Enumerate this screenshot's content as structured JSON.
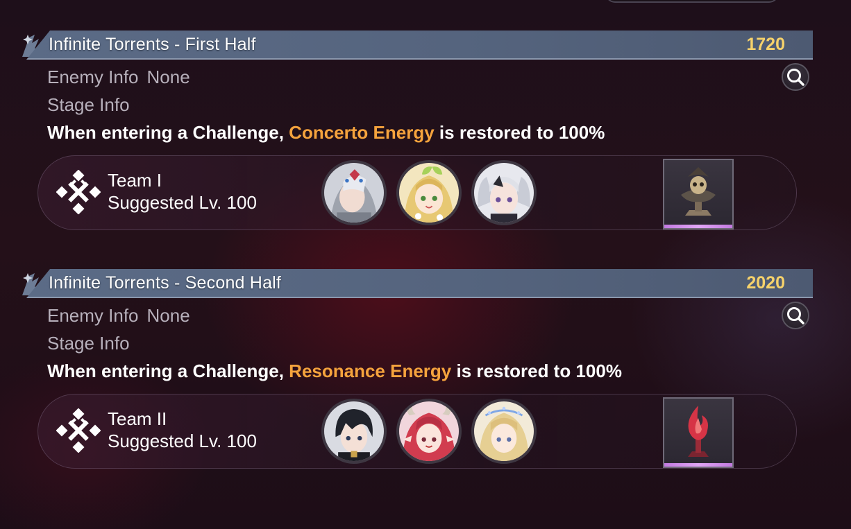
{
  "stages": [
    {
      "title": "Infinite Torrents - First Half",
      "score": "1720",
      "enemy_info_label": "Enemy Info",
      "enemy_info_value": "None",
      "stage_info_label": "Stage Info",
      "description": {
        "prefix": "When entering a Challenge,",
        "highlight": "Concerto Energy",
        "suffix": "is restored to 100%"
      },
      "team": {
        "name": "Team I",
        "suggested_level": "Suggested Lv. 100",
        "members": [
          "masked-silver-hair-character",
          "blonde-leaf-character",
          "silver-twintail-character"
        ],
        "echo": "bronze-skull-echo"
      }
    },
    {
      "title": "Infinite Torrents - Second Half",
      "score": "2020",
      "enemy_info_label": "Enemy Info",
      "enemy_info_value": "None",
      "stage_info_label": "Stage Info",
      "description": {
        "prefix": "When entering a Challenge,",
        "highlight": "Resonance Energy",
        "suffix": "is restored to 100%"
      },
      "team": {
        "name": "Team II",
        "suggested_level": "Suggested Lv. 100",
        "members": [
          "dark-hair-character",
          "red-hair-horned-character",
          "blonde-crowned-character"
        ],
        "echo": "crimson-flame-echo"
      }
    }
  ],
  "colors": {
    "accent": "#f5a33d",
    "score": "#f6d26b",
    "header": "#5b6b86",
    "echo_rarity": "#d190ee"
  }
}
